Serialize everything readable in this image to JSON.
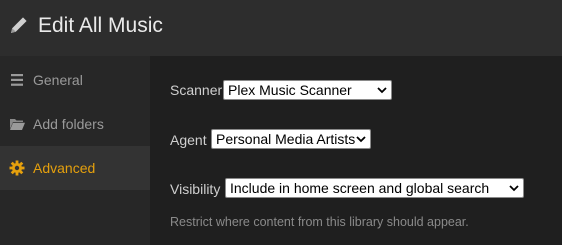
{
  "header": {
    "title": "Edit All Music",
    "icon": "pencil-icon"
  },
  "sidebar": {
    "items": [
      {
        "label": "General",
        "icon": "list-icon",
        "active": false
      },
      {
        "label": "Add folders",
        "icon": "folder-icon",
        "active": false
      },
      {
        "label": "Advanced",
        "icon": "gear-icon",
        "active": true
      }
    ]
  },
  "form": {
    "scanner": {
      "label": "Scanner",
      "value": "Plex Music Scanner"
    },
    "agent": {
      "label": "Agent",
      "value": "Personal Media Artists"
    },
    "visibility": {
      "label": "Visibility",
      "value": "Include in home screen and global search",
      "hint": "Restrict where content from this library should appear."
    }
  },
  "colors": {
    "accent": "#e5a00d",
    "header_bg": "#2d2d2d",
    "sidebar_bg": "#272727",
    "content_bg": "#1f1f1f"
  }
}
